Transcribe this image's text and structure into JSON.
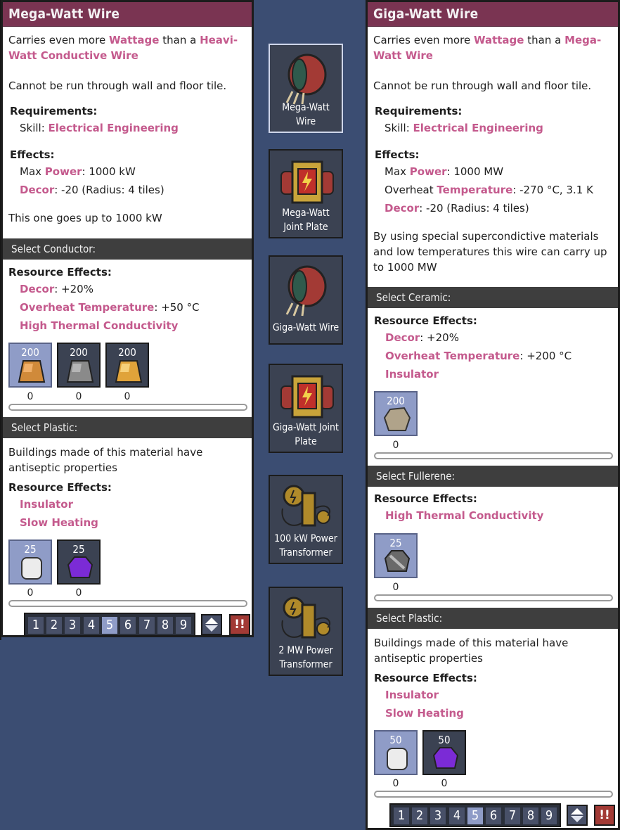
{
  "left": {
    "title": "Mega-Watt Wire",
    "desc_parts": [
      "Carries even more ",
      "Wattage",
      " than a ",
      "Heavi-Watt Conductive Wire"
    ],
    "no_wall": "Cannot be run through wall and floor tile.",
    "req_label": "Requirements:",
    "skill_label": "Skill: ",
    "skill": "Electrical Engineering",
    "effects_label": "Effects:",
    "max_label": "Max ",
    "power_word": "Power",
    "power_value": ": 1000 kW",
    "decor_word": "Decor",
    "decor_value": ": -20 (Radius: 4 tiles)",
    "flavor": "This one goes up to 1000 kW",
    "conductor": {
      "heading": "Select Conductor:",
      "res_label": "Resource Effects:",
      "decor_word": "Decor",
      "decor_value": ": +20%",
      "overheat_word": "Overheat Temperature",
      "overheat_value": ": +50 °C",
      "thermal": "High Thermal Conductivity",
      "swatches": [
        {
          "count": "200",
          "qty": "0",
          "icon": "copper-ore-icon",
          "color": "#d08a3a"
        },
        {
          "count": "200",
          "qty": "0",
          "icon": "iron-ore-icon",
          "color": "#8a8a8a"
        },
        {
          "count": "200",
          "qty": "0",
          "icon": "gold-ore-icon",
          "color": "#e0a33a"
        }
      ]
    },
    "plastic": {
      "heading": "Select Plastic:",
      "desc": "Buildings made of this material have antiseptic properties",
      "res_label": "Resource Effects:",
      "insulator": "Insulator",
      "slow": "Slow Heating",
      "swatches": [
        {
          "count": "25",
          "qty": "0",
          "icon": "plastic-icon",
          "color": "#e8e8e8"
        },
        {
          "count": "25",
          "qty": "0",
          "icon": "superinsulator-icon",
          "color": "#7b2bd6"
        }
      ]
    }
  },
  "right": {
    "title": "Giga-Watt Wire",
    "desc_parts": [
      "Carries even more ",
      "Wattage",
      " than a ",
      "Mega-Watt Wire"
    ],
    "no_wall": "Cannot be run through wall and floor tile.",
    "req_label": "Requirements:",
    "skill_label": "Skill: ",
    "skill": "Electrical Engineering",
    "effects_label": "Effects:",
    "max_label": "Max ",
    "power_word": "Power",
    "power_value": ": 1000 MW",
    "overheat_label": "Overheat ",
    "temp_word": "Temperature",
    "temp_value": ": -270 °C, 3.1 K",
    "decor_word": "Decor",
    "decor_value": ": -20 (Radius: 4 tiles)",
    "flavor": "By using special supercondictive materials and low temperatures this wire can carry up to 1000 MW",
    "ceramic": {
      "heading": "Select Ceramic:",
      "res_label": "Resource Effects:",
      "decor_word": "Decor",
      "decor_value": ": +20%",
      "overheat_word": "Overheat Temperature",
      "overheat_value": ": +200 °C",
      "insulator": "Insulator",
      "swatches": [
        {
          "count": "200",
          "qty": "0",
          "icon": "ceramic-icon",
          "color": "#b0a38a"
        }
      ]
    },
    "fullerene": {
      "heading": "Select Fullerene:",
      "res_label": "Resource Effects:",
      "thermal": "High Thermal Conductivity",
      "swatches": [
        {
          "count": "25",
          "qty": "0",
          "icon": "fullerene-icon",
          "color": "#6a6a6a"
        }
      ]
    },
    "plastic": {
      "heading": "Select Plastic:",
      "desc": "Buildings made of this material have antiseptic properties",
      "res_label": "Resource Effects:",
      "insulator": "Insulator",
      "slow": "Slow Heating",
      "swatches": [
        {
          "count": "50",
          "qty": "0",
          "icon": "plastic-icon",
          "color": "#e8e8e8"
        },
        {
          "count": "50",
          "qty": "0",
          "icon": "superinsulator-icon",
          "color": "#7b2bd6"
        }
      ]
    }
  },
  "numbar": {
    "keys": [
      "1",
      "2",
      "3",
      "4",
      "5",
      "6",
      "7",
      "8",
      "9"
    ],
    "active": "5",
    "alert": "!!"
  },
  "buildings": [
    {
      "label1": "Mega-Watt",
      "label2": "Wire",
      "icon": "wire-spool-icon",
      "selected": true
    },
    {
      "label1": "Mega-Watt",
      "label2": "Joint Plate",
      "icon": "joint-plate-icon",
      "selected": false
    },
    {
      "label1": "Giga-Watt Wire",
      "label2": "",
      "icon": "wire-spool-icon",
      "selected": false
    },
    {
      "label1": "Giga-Watt Joint",
      "label2": "Plate",
      "icon": "joint-plate-icon",
      "selected": false
    },
    {
      "label1": "100 kW Power",
      "label2": "Transformer",
      "icon": "transformer-icon",
      "selected": false
    },
    {
      "label1": "2 MW Power",
      "label2": "Transformer",
      "icon": "transformer-icon",
      "selected": false
    }
  ],
  "colors": {
    "title_bar": "#7a3452",
    "highlight": "#c45a8d",
    "section_bar": "#3e3e3e",
    "background": "#3b4d72"
  }
}
